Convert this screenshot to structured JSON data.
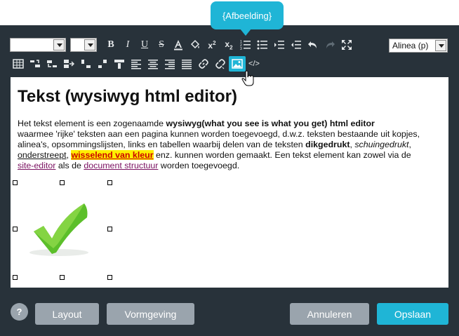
{
  "tooltip": "{Afbeelding}",
  "toolbar": {
    "style_select": "Alinea (p)",
    "row1": [
      "bold",
      "italic",
      "underline",
      "strikethrough",
      "font-color",
      "highlight",
      "superscript",
      "subscript",
      "numbered-list",
      "bullet-list",
      "indent",
      "outdent",
      "undo",
      "redo",
      "fullscreen"
    ],
    "row2": [
      "table",
      "row-above",
      "row-below",
      "col-left",
      "col-right",
      "delete-row",
      "delete-col",
      "align-left",
      "align-center",
      "align-right",
      "justify",
      "link",
      "unlink",
      "image",
      "source"
    ]
  },
  "editor": {
    "heading": "Tekst (wysiwyg html editor)",
    "p1": "Het tekst element is een zogenaamde ",
    "p1_bold": "wysiwyg(what you see is what you get) html editor",
    "p2": "waarmee 'rijke' teksten aan een pagina kunnen worden toegevoegd, d.w.z. teksten bestaande uit kopjes, alinea's, opsommingslijsten, links en tabellen waarbij delen van de teksten ",
    "p2_bold": "dikgedrukt",
    "p2_sep": ", ",
    "p2_italic": "schuingedrukt",
    "p2_comma": ",",
    "underline": "onderstreept",
    "comma2": ", ",
    "highlight": "wisselend van kleur",
    "p3": " enz. kunnen worden gemaakt. Een tekst element kan zowel via de ",
    "link1": "site-editor",
    "p4": " als de ",
    "link2": "document structuur",
    "p5": " worden toegevoegd."
  },
  "buttons": {
    "help": "?",
    "layout": "Layout",
    "vormgeving": "Vormgeving",
    "annuleren": "Annuleren",
    "opslaan": "Opslaan"
  },
  "colors": {
    "accent": "#1fb5d6",
    "panel": "#28323a",
    "button_gray": "#9aa4ad"
  }
}
